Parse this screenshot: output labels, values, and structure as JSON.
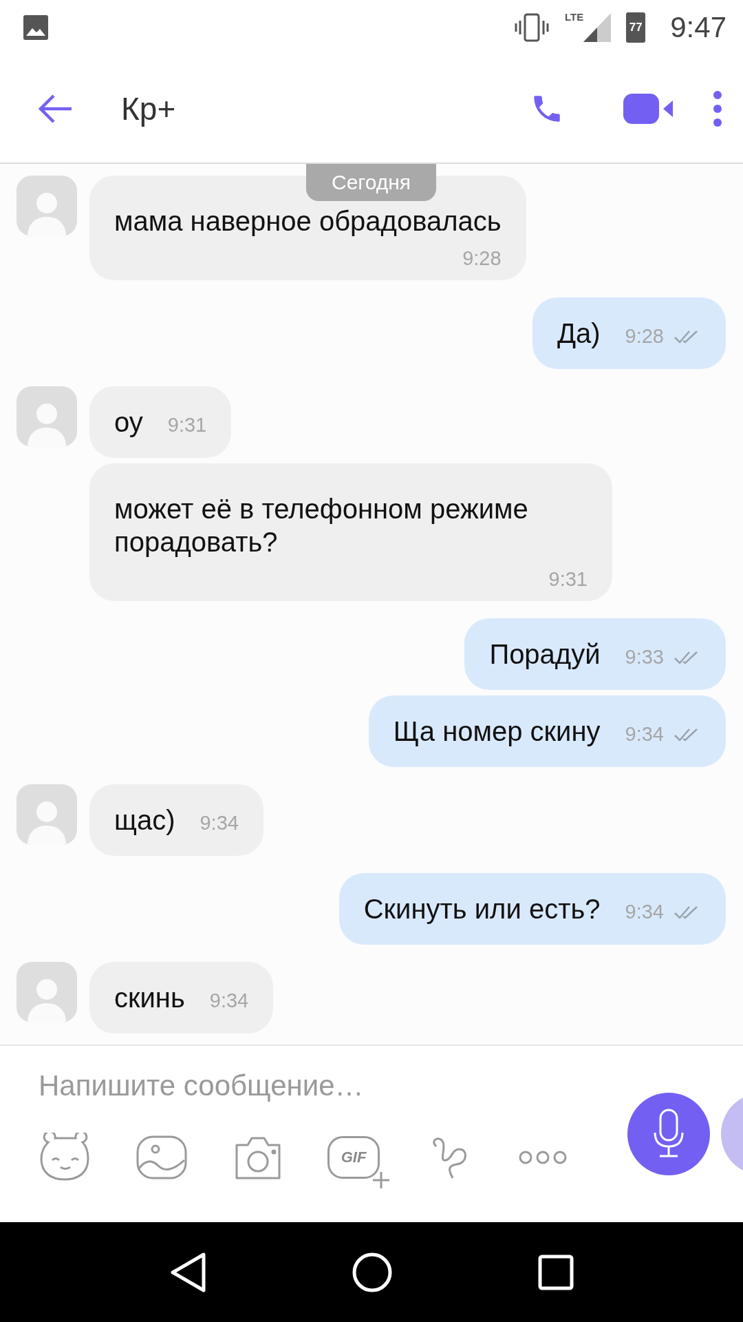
{
  "status_bar": {
    "network": "LTE",
    "battery": "77",
    "time": "9:47"
  },
  "header": {
    "title": "Кр+"
  },
  "date_pill": "Сегодня",
  "messages": [
    {
      "kind": "incoming",
      "text": "мама наверное обрадовалась",
      "time": "9:28",
      "time_below": true
    },
    {
      "kind": "outgoing",
      "text": "Да)",
      "time": "9:28",
      "time_below": false
    },
    {
      "kind": "incoming",
      "text": "оу",
      "time": "9:31",
      "time_below": false
    },
    {
      "kind": "incoming",
      "text": "может её в телефонном режиме порадовать?",
      "time": "9:31",
      "time_below": true
    },
    {
      "kind": "outgoing",
      "text": "Порадуй",
      "time": "9:33",
      "time_below": false
    },
    {
      "kind": "outgoing",
      "text": "Ща номер скину",
      "time": "9:34",
      "time_below": false
    },
    {
      "kind": "incoming",
      "text": "щас)",
      "time": "9:34",
      "time_below": false
    },
    {
      "kind": "outgoing",
      "text": "Скинуть или есть?",
      "time": "9:34",
      "time_below": false
    },
    {
      "kind": "incoming",
      "text": "скинь",
      "time": "9:34",
      "time_below": false
    }
  ],
  "composer": {
    "placeholder": "Напишите сообщение…",
    "gif_label": "GIF"
  }
}
